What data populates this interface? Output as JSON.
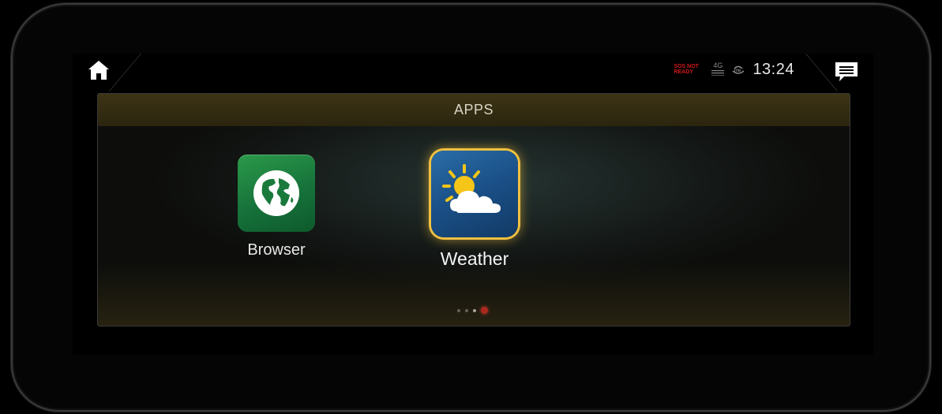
{
  "status": {
    "sos_line1": "SOS NOT",
    "sos_line2": "READY",
    "network": "4G",
    "clock": "13:24"
  },
  "panel": {
    "title": "APPS"
  },
  "apps": [
    {
      "label": "Browser",
      "icon": "globe-icon",
      "color": "#1f8a44"
    },
    {
      "label": "Weather",
      "icon": "sun-cloud-icon",
      "color": "#1a5a94",
      "selected": true
    }
  ],
  "pager": {
    "pages": 4,
    "current": 4
  },
  "colors": {
    "header": "#3d3414",
    "focus_glow": "#f0c040",
    "sos_warning": "#d01818",
    "pager_current": "#e02020"
  }
}
